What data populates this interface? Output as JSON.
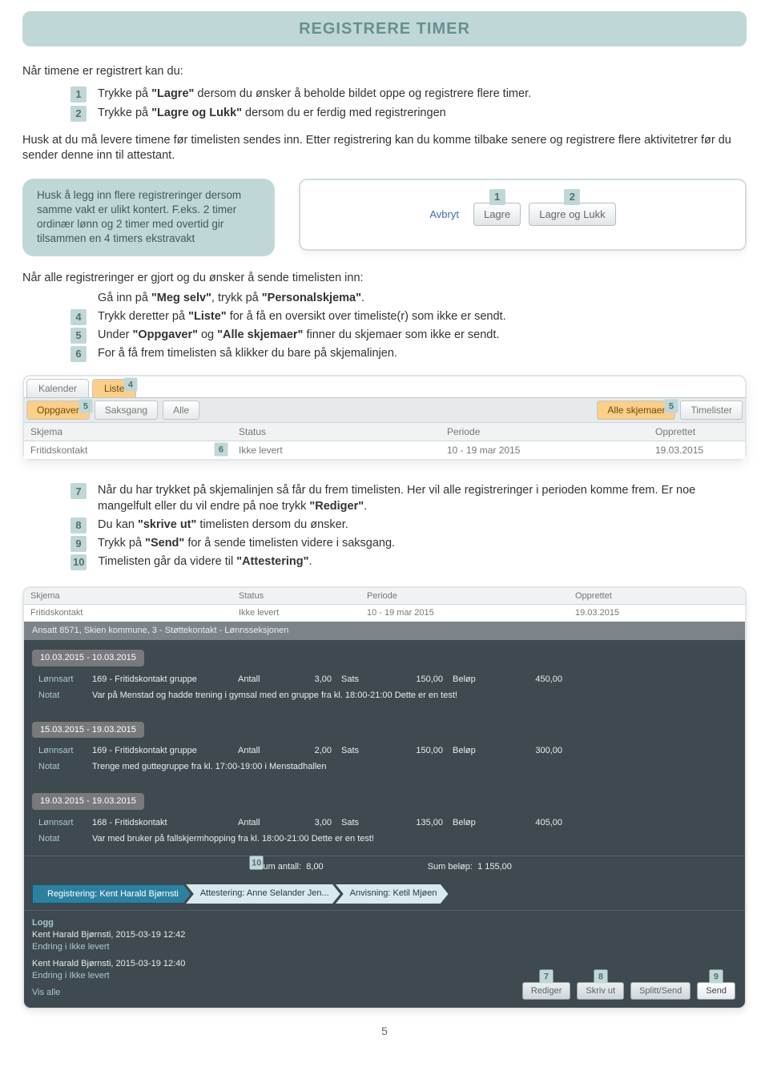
{
  "title": "REGISTRERE TIMER",
  "intro": "Når timene er registrert kan du:",
  "stepsA": [
    {
      "n": "1",
      "text_before": "Trykke på ",
      "bold": "\"Lagre\"",
      "text_after": " dersom du ønsker å beholde bildet oppe og registrere flere timer."
    },
    {
      "n": "2",
      "text_before": "Trykke på ",
      "bold": "\"Lagre og Lukk\"",
      "text_after": " dersom du er ferdig med registreringen"
    }
  ],
  "para1": "Husk at du må levere timene før timelisten sendes inn. Etter registrering kan du komme tilbake senere og registrere flere aktivitetrer før du sender denne inn til attestant.",
  "aside": "Husk å legg inn flere registreringer dersom samme vakt er ulikt kontert. F.eks. 2 timer ordinær lønn og 2 timer med overtid gir tilsammen en 4 timers ekstravakt",
  "btnshot": {
    "cancel": "Avbryt",
    "save": "Lagre",
    "saveclose": "Lagre og Lukk",
    "n1": "1",
    "n2": "2"
  },
  "sub2": "Når alle registreringer er gjort og du ønsker å sende timelisten inn:",
  "stepsB_pre": {
    "before": "Gå inn på ",
    "b1": "\"Meg selv\"",
    "mid": ", trykk på ",
    "b2": "\"Personalskjema\"",
    "after": "."
  },
  "stepsB": [
    {
      "n": "4",
      "pre": "Trykk deretter på ",
      "b": "\"Liste\"",
      "post": " for å få en oversikt over timeliste(r) som ikke er sendt."
    },
    {
      "n": "5",
      "pre": "Under ",
      "b": "\"Oppgaver\"",
      "mid": " og ",
      "b2": "\"Alle skjemaer\"",
      "post": " finner du skjemaer som ikke er sendt."
    },
    {
      "n": "6",
      "pre": "For å få frem timelisten så klikker du bare på skjemalinjen.",
      "b": "",
      "post": ""
    }
  ],
  "shot1": {
    "tab1": "Kalender",
    "tab2": "Liste",
    "n4": "4",
    "f1": "Oppgaver",
    "n5a": "5",
    "f2": "Saksgang",
    "f3": "Alle",
    "f4": "Alle skjemaer",
    "n5b": "5",
    "f5": "Timelister",
    "h1": "Skjema",
    "h2": "Status",
    "h3": "Periode",
    "h4": "Opprettet",
    "r1": "Fritidskontakt",
    "n6": "6",
    "r2": "Ikke levert",
    "r3": "10 - 19 mar 2015",
    "r4": "19.03.2015"
  },
  "stepsC": [
    {
      "n": "7",
      "text": "Når du har trykket på skjemalinjen så får du frem timelisten. Her vil alle registreringer i perioden komme frem. Er noe mangelfult eller du vil endre på noe trykk ",
      "b": "\"Rediger\"",
      "post": "."
    },
    {
      "n": "8",
      "text": "Du kan ",
      "b": "\"skrive ut\"",
      "post": " timelisten dersom du ønsker."
    },
    {
      "n": "9",
      "text": "Trykk på ",
      "b": "\"Send\"",
      "post": " for å sende timelisten videre i saksgang."
    },
    {
      "n": "10",
      "text": "Timelisten går da videre til ",
      "b": "\"Attestering\"",
      "post": "."
    }
  ],
  "shot2": {
    "h1": "Skjema",
    "h2": "Status",
    "h3": "Periode",
    "h4": "Opprettet",
    "r1": "Fritidskontakt",
    "r2": "Ikke levert",
    "r3": "10 - 19 mar 2015",
    "r4": "19.03.2015",
    "sub": "Ansatt 8571, Skien kommune, 3 - Støttekontakt - Lønnsseksjonen",
    "blocks": [
      {
        "date": "10.03.2015 - 10.03.2015",
        "lart": "169 - Fritidskontakt gruppe",
        "ant": "3,00",
        "sats": "150,00",
        "bel": "450,00",
        "notat": "Var på Menstad og hadde trening i gymsal med en gruppe fra kl. 18:00-21:00 Dette er en test!"
      },
      {
        "date": "15.03.2015 - 19.03.2015",
        "lart": "169 - Fritidskontakt gruppe",
        "ant": "2,00",
        "sats": "150,00",
        "bel": "300,00",
        "notat": "Trenge med guttegruppe fra kl. 17:00-19:00 i Menstadhallen"
      },
      {
        "date": "19.03.2015 - 19.03.2015",
        "lart": "168 - Fritidskontakt",
        "ant": "3,00",
        "sats": "135,00",
        "bel": "405,00",
        "notat": "Var med bruker på fallskjermhopping fra kl. 18:00-21:00 Dette er en test!"
      }
    ],
    "labels": {
      "lonnsart": "Lønnsart",
      "antall": "Antall",
      "sats": "Sats",
      "belop": "Beløp",
      "notat": "Notat"
    },
    "sum": {
      "a_lbl": "Sum antall:",
      "a": "8,00",
      "b_lbl": "Sum beløp:",
      "b": "1 155,00",
      "n10": "10"
    },
    "bc": {
      "c1": "Registrering: Kent Harald Bjørnsti",
      "c2": "Attestering: Anne Selander Jen...",
      "c3": "Anvisning: Ketil Mjøen"
    },
    "log": {
      "title": "Logg",
      "l1": "Kent Harald Bjørnsti, 2015-03-19 12:42",
      "l1b": "Endring i Ikke levert",
      "l2": "Kent Harald Bjørnsti, 2015-03-19 12:40",
      "l2b": "Endring i Ikke levert",
      "all": "Vis alle"
    },
    "actions": {
      "a1": "Rediger",
      "n7": "7",
      "a2": "Skriv ut",
      "n8": "8",
      "a3": "Splitt/Send",
      "a4": "Send",
      "n9": "9"
    }
  },
  "pageno": "5"
}
